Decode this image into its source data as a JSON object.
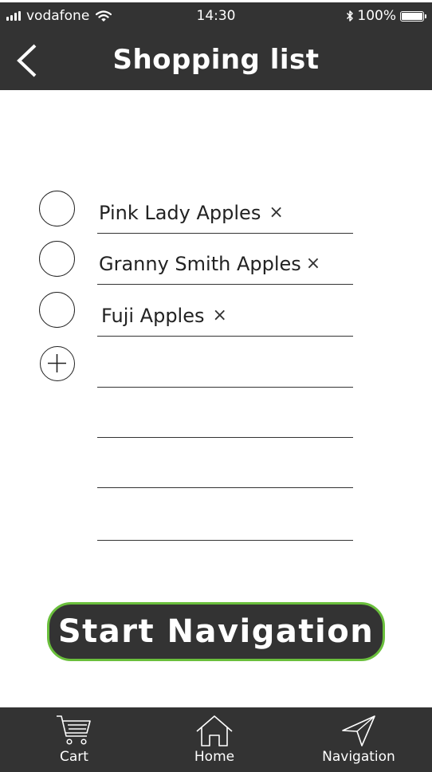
{
  "status_bar": {
    "carrier": "vodafone",
    "time": "14:30",
    "battery": "100%",
    "signal_icon": "signal-bars-icon",
    "wifi_icon": "wifi-icon",
    "bluetooth_icon": "bluetooth-icon",
    "battery_icon": "battery-icon"
  },
  "header": {
    "title": "Shopping list",
    "back_icon": "chevron-left-icon"
  },
  "list": {
    "items": [
      {
        "label": "Pink Lady Apples",
        "remove": "×",
        "checked": false
      },
      {
        "label": "Granny Smith Apples",
        "remove": "×",
        "checked": false
      },
      {
        "label": "Fuji Apples",
        "remove": "×",
        "checked": false
      }
    ],
    "add_icon": "plus-circle-icon",
    "add_value": ""
  },
  "start_button": {
    "label": "Start Navigation",
    "border_color": "#6abf3c"
  },
  "tab_bar": {
    "tabs": [
      {
        "label": "Cart",
        "icon": "cart-icon"
      },
      {
        "label": "Home",
        "icon": "home-icon"
      },
      {
        "label": "Navigation",
        "icon": "navigation-arrow-icon"
      }
    ]
  },
  "colors": {
    "bar_background": "#333333",
    "accent": "#6abf3c",
    "text_light": "#ffffff"
  }
}
